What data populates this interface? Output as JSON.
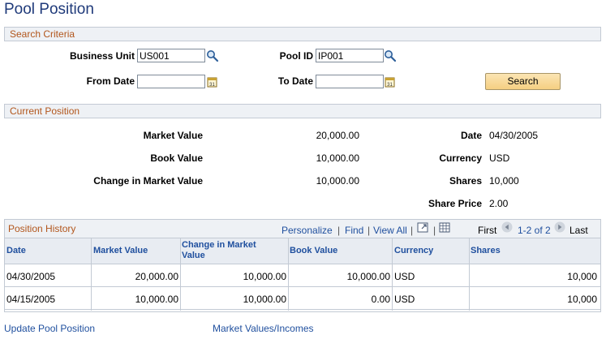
{
  "page_title": "Pool Position",
  "search": {
    "section_title": "Search Criteria",
    "business_unit_label": "Business Unit",
    "business_unit_value": "US001",
    "pool_id_label": "Pool ID",
    "pool_id_value": "IP001",
    "from_date_label": "From Date",
    "from_date_value": "",
    "to_date_label": "To Date",
    "to_date_value": "",
    "search_button": "Search"
  },
  "current": {
    "section_title": "Current Position",
    "market_value_label": "Market Value",
    "market_value": "20,000.00",
    "book_value_label": "Book Value",
    "book_value": "10,000.00",
    "change_label": "Change in Market Value",
    "change_value": "10,000.00",
    "date_label": "Date",
    "date_value": "04/30/2005",
    "currency_label": "Currency",
    "currency_value": "USD",
    "shares_label": "Shares",
    "shares_value": "10,000",
    "share_price_label": "Share Price",
    "share_price_value": "2.00"
  },
  "history": {
    "title": "Position History",
    "personalize": "Personalize",
    "find": "Find",
    "view_all": "View All",
    "sep": "|",
    "first": "First",
    "range": "1-2 of 2",
    "last": "Last",
    "columns": [
      "Date",
      "Market Value",
      "Change in Market Value",
      "Book Value",
      "Currency",
      "Shares"
    ],
    "rows": [
      {
        "date": "04/30/2005",
        "market_value": "20,000.00",
        "change": "10,000.00",
        "book_value": "10,000.00",
        "currency": "USD",
        "shares": "10,000"
      },
      {
        "date": "04/15/2005",
        "market_value": "10,000.00",
        "change": "10,000.00",
        "book_value": "0.00",
        "currency": "USD",
        "shares": "10,000"
      }
    ]
  },
  "links": {
    "update_pool_position": "Update Pool Position",
    "market_values_incomes": "Market Values/Incomes"
  },
  "colors": {
    "title_blue": "#1f3a7a",
    "section_orange": "#b2561c",
    "link_blue": "#1f4f9e",
    "button_gold": "#f5cf82"
  }
}
